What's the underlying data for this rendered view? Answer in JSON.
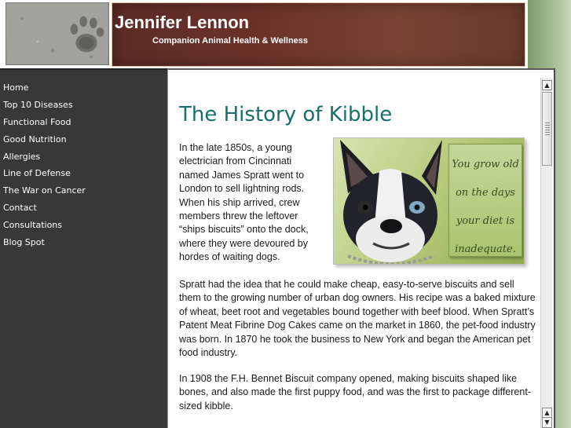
{
  "header": {
    "site_title": "Jennifer Lennon",
    "site_subtitle": "Companion Animal Health & Wellness"
  },
  "sidebar": {
    "items": [
      {
        "label": "Home"
      },
      {
        "label": "Top 10 Diseases"
      },
      {
        "label": "Functional Food"
      },
      {
        "label": "Good Nutrition"
      },
      {
        "label": "Allergies"
      },
      {
        "label": "Line of Defense"
      },
      {
        "label": "The War on Cancer"
      },
      {
        "label": "Contact"
      },
      {
        "label": "Consultations"
      },
      {
        "label": "Blog Spot"
      }
    ]
  },
  "main": {
    "title": "The History of Kibble",
    "paragraph1": "In the late 1850s, a young electrician from Cincinnati named James Spratt went to London to sell lightning rods. When his ship arrived, crew members threw the leftover “ships biscuits” onto the dock, where they were devoured by hordes of waiting dogs.",
    "paragraph2": "Spratt had the idea that he could make cheap, easy-to-serve biscuits and sell them to the growing number of urban dog owners. His recipe was a baked mixture of wheat, beet root and vegetables bound together with beef blood. When Spratt’s Patent Meat Fibrine Dog Cakes came on the market in 1860, the pet-food industry was born. In 1870 he took the business to New York and began the American pet food industry.",
    "paragraph3": "In 1908 the F.H. Bennet Biscuit company opened, making biscuits shaped like bones, and also made the first puppy food, and was the first to package different-sized kibble.",
    "image_quote": [
      "You grow old",
      "on the days",
      "your diet is",
      "inadequate."
    ]
  },
  "scrollbar": {
    "up_glyph": "▲",
    "down_glyph": "▼"
  },
  "colors": {
    "title": "#1a6e6e",
    "sidebar": "#383838",
    "banner": "#6b3129",
    "page_bg": "#8aa57a"
  }
}
